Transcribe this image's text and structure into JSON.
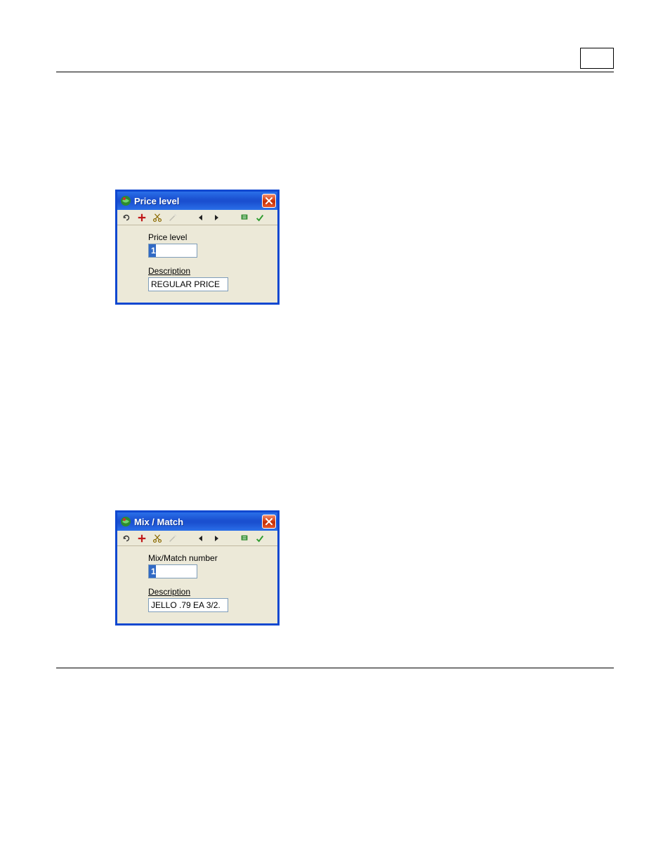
{
  "header": {
    "title": "",
    "page_number": ""
  },
  "sections": [
    {
      "heading": "Price level",
      "para1": "",
      "para2": ""
    },
    {
      "heading": "Mix / Match",
      "para1": "",
      "para2": "",
      "para3": ""
    }
  ],
  "dialog1": {
    "title": "Price level",
    "toolbar": {
      "undo": "undo",
      "add": "add",
      "cut": "cut",
      "wand": "wand",
      "prev": "previous",
      "next": "next",
      "tool": "tool",
      "ok": "ok"
    },
    "price_level_label": "Price level",
    "price_level_value": "1",
    "description_label": "Description",
    "description_value": "REGULAR PRICE"
  },
  "dialog2": {
    "title": "Mix / Match",
    "toolbar": {
      "undo": "undo",
      "add": "add",
      "cut": "cut",
      "wand": "wand",
      "prev": "previous",
      "next": "next",
      "tool": "tool",
      "ok": "ok"
    },
    "mixmatch_label": "Mix/Match number",
    "mixmatch_value": "1",
    "description_label": "Description",
    "description_value": "JELLO .79 EA 3/2."
  },
  "footer": {
    "left": "",
    "right": ""
  }
}
